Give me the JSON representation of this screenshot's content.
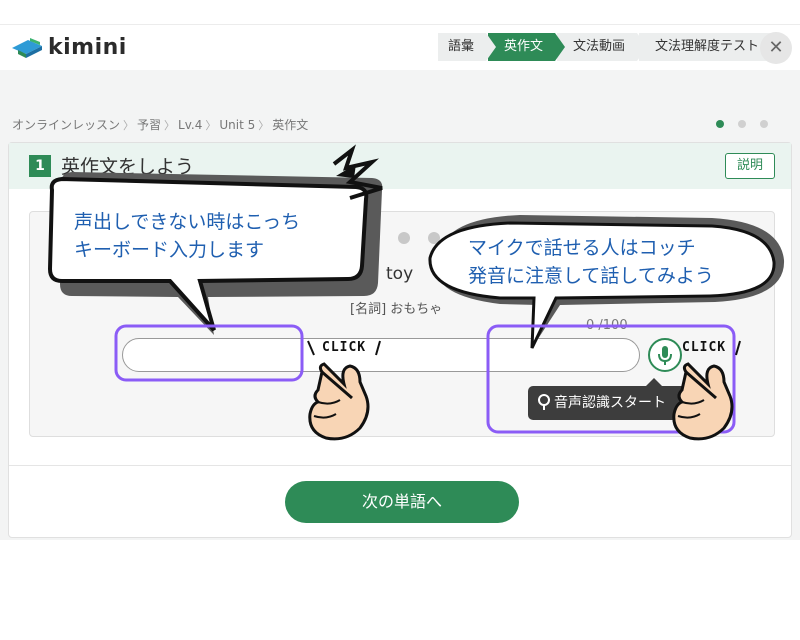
{
  "header": {
    "logo_text": "kimini",
    "steps": [
      "語彙",
      "英作文",
      "文法動画",
      "文法理解度テスト"
    ],
    "active_step": 1,
    "close_label": "✕"
  },
  "breadcrumb": [
    "オンラインレッスン",
    "予習",
    "Lv.4",
    "Unit 5",
    "英作文"
  ],
  "page_dots": {
    "count": 3,
    "active": 0
  },
  "card": {
    "number": "1",
    "title": "英作文をしよう",
    "explain_label": "説明"
  },
  "exercise": {
    "word": "toy",
    "meaning": "[名詞] おもちゃ",
    "counter": "0 /100",
    "input_value": "",
    "tooltip": "音声認識スタート"
  },
  "next_button": "次の単語へ",
  "annotations": {
    "left_bubble_lines": [
      "声出しできない時はこっち",
      "キーボード入力します"
    ],
    "right_bubble_lines": [
      "マイクで話せる人はコッチ",
      "発音に注意して話してみよう"
    ],
    "click_label_left": "CLICK",
    "click_label_right": "CLICK",
    "highlight_color": "#8b5cf6",
    "bubble_text_color": "#1f5fb0"
  },
  "colors": {
    "accent": "#2e8b57",
    "card_header_bg": "#eaf4f0"
  }
}
